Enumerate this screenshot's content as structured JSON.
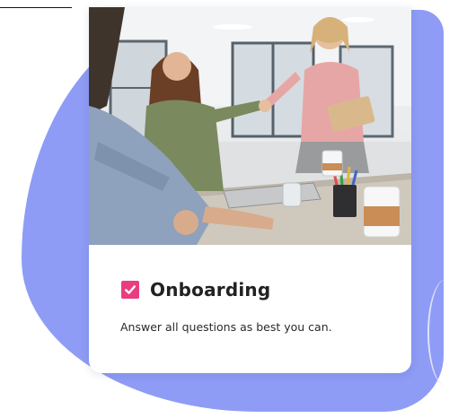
{
  "colors": {
    "accent_blob": "#8e9cf6",
    "check_badge": "#e83e7f",
    "title_text": "#222222",
    "body_text": "#2a2a2a",
    "card_bg": "#ffffff"
  },
  "card": {
    "image_icon": "office-handshake-photo",
    "badge_icon": "checkmark-icon",
    "title": "Onboarding",
    "description": "Answer all questions as best you can."
  }
}
